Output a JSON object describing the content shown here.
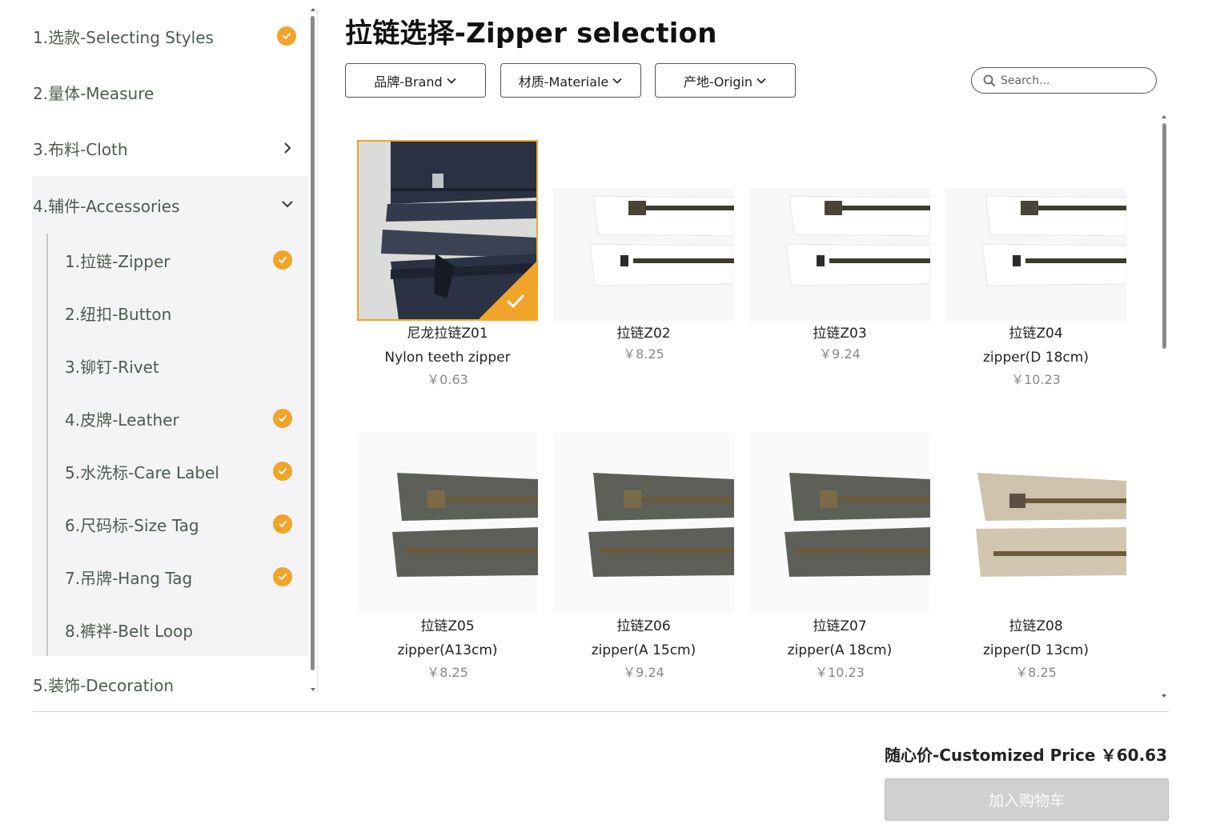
{
  "sidebar": {
    "items": [
      {
        "label": "1.选款-Selecting Styles",
        "checked": true
      },
      {
        "label": "2.量体-Measure",
        "checked": false
      },
      {
        "label": "3.布料-Cloth",
        "expandable": true
      },
      {
        "label": "4.辅件-Accessories",
        "expanded": true
      },
      {
        "label": "5.装饰-Decoration"
      }
    ],
    "sub_items": [
      {
        "label": "1.拉链-Zipper",
        "checked": true
      },
      {
        "label": "2.纽扣-Button",
        "checked": false
      },
      {
        "label": "3.铆钉-Rivet",
        "checked": false
      },
      {
        "label": "4.皮牌-Leather",
        "checked": true
      },
      {
        "label": "5.水洗标-Care Label",
        "checked": true
      },
      {
        "label": "6.尺码标-Size Tag",
        "checked": true
      },
      {
        "label": "7.吊牌-Hang Tag",
        "checked": true
      },
      {
        "label": "8.裤袢-Belt Loop",
        "checked": false
      }
    ]
  },
  "main": {
    "title": "拉链选择-Zipper selection",
    "filters": [
      {
        "label": "品牌-Brand"
      },
      {
        "label": "材质-Materiale"
      },
      {
        "label": "产地-Origin"
      }
    ],
    "search": {
      "placeholder": "Search..."
    }
  },
  "products": [
    {
      "name": "尼龙拉链Z01",
      "desc": "Nylon teeth zipper",
      "price": "￥0.63",
      "selected": true,
      "color": "navy"
    },
    {
      "name": "拉链Z02",
      "desc": "",
      "price": "￥8.25",
      "color": "white"
    },
    {
      "name": "拉链Z03",
      "desc": "",
      "price": "￥9.24",
      "color": "white"
    },
    {
      "name": "拉链Z04",
      "desc": "zipper(D 18cm)",
      "price": "￥10.23",
      "color": "white"
    },
    {
      "name": "拉链Z05",
      "desc": "zipper(A13cm)",
      "price": "￥8.25",
      "color": "olive"
    },
    {
      "name": "拉链Z06",
      "desc": "zipper(A 15cm)",
      "price": "￥9.24",
      "color": "olive"
    },
    {
      "name": "拉链Z07",
      "desc": "zipper(A 18cm)",
      "price": "￥10.23",
      "color": "olive"
    },
    {
      "name": "拉链Z08",
      "desc": "zipper(D 13cm)",
      "price": "￥8.25",
      "color": "beige"
    }
  ],
  "footer": {
    "price_label": "随心价-Customized Price",
    "price_value": "￥60.63",
    "cart_label": "加入购物车"
  },
  "colors": {
    "accent": "#f0a52a",
    "nav_text": "#4d5b4d",
    "sub_bg": "#f4f4f6"
  }
}
